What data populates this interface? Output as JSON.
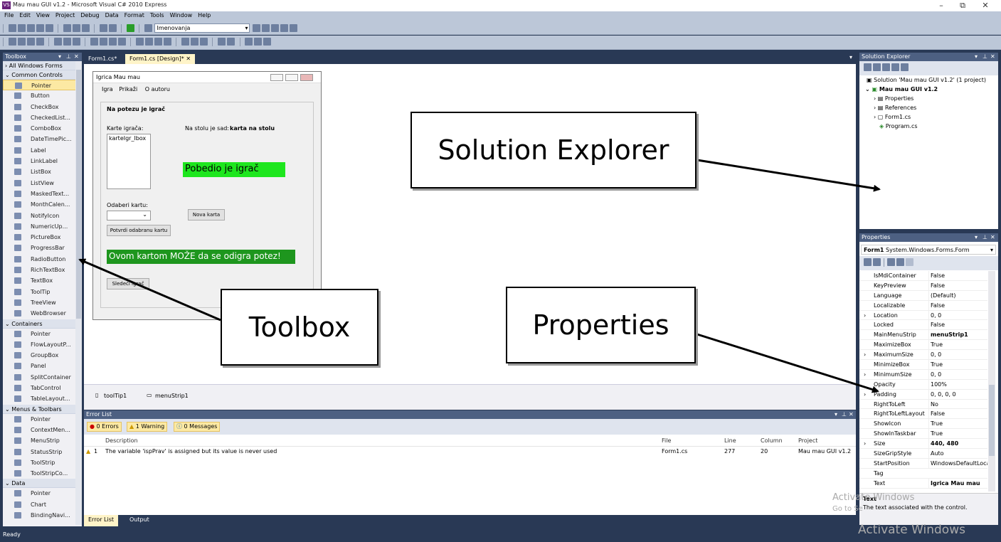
{
  "window": {
    "title": "Mau mau GUI v1.2 - Microsoft Visual C# 2010 Express",
    "app_icon": "vs-icon",
    "minimize": "–",
    "restore": "⧉",
    "close": "✕"
  },
  "menu": [
    "File",
    "Edit",
    "View",
    "Project",
    "Debug",
    "Data",
    "Format",
    "Tools",
    "Window",
    "Help"
  ],
  "toolbar": {
    "config_combo": "Imenovanja"
  },
  "toolbox": {
    "title": "Toolbox",
    "categories": [
      {
        "label": "All Windows Forms",
        "items": []
      },
      {
        "label": "Common Controls",
        "items": [
          "Pointer",
          "Button",
          "CheckBox",
          "CheckedList...",
          "ComboBox",
          "DateTimePic...",
          "Label",
          "LinkLabel",
          "ListBox",
          "ListView",
          "MaskedText...",
          "MonthCalen...",
          "NotifyIcon",
          "NumericUp...",
          "PictureBox",
          "ProgressBar",
          "RadioButton",
          "RichTextBox",
          "TextBox",
          "ToolTip",
          "TreeView",
          "WebBrowser"
        ]
      },
      {
        "label": "Containers",
        "items": [
          "Pointer",
          "FlowLayoutP...",
          "GroupBox",
          "Panel",
          "SplitContainer",
          "TabControl",
          "TableLayout..."
        ]
      },
      {
        "label": "Menus & Toolbars",
        "items": [
          "Pointer",
          "ContextMen...",
          "MenuStrip",
          "StatusStrip",
          "ToolStrip",
          "ToolStripCo..."
        ]
      },
      {
        "label": "Data",
        "items": [
          "Pointer",
          "Chart",
          "BindingNavi..."
        ]
      }
    ]
  },
  "doc_tabs": [
    {
      "label": "Form1.cs*"
    },
    {
      "label": "Form1.cs [Design]*"
    }
  ],
  "form": {
    "title": "Igrica Mau mau",
    "menu": [
      "Igra",
      "Prikaži",
      "O autoru"
    ],
    "turn_label": "Na potezu je igrač",
    "cards_label": "Karte igrača:",
    "listbox_text": "karteIgr_lbox",
    "table_label": "Na stolu je sad:",
    "table_value": "karta na stolu",
    "winner_text": "Pobedio je igrač",
    "choose_label": "Odaberi kartu:",
    "new_card_button": "Nova karta",
    "confirm_button": "Potvrdi odabranu kartu",
    "status_text": "Ovom kartom MOŽE da se odigra potez!",
    "next_button": "Sledeći igrač"
  },
  "tray": {
    "items": [
      "toolTip1",
      "menuStrip1"
    ]
  },
  "error_list": {
    "title": "Error List",
    "errors": "0 Errors",
    "warnings": "1 Warning",
    "messages": "0 Messages",
    "columns": [
      "Description",
      "File",
      "Line",
      "Column",
      "Project"
    ],
    "rows": [
      {
        "num": "1",
        "description": "The variable 'ispPrav' is assigned but its value is never used",
        "file": "Form1.cs",
        "line": "277",
        "column": "20",
        "project": "Mau mau GUI v1.2"
      }
    ]
  },
  "bottom_tabs": [
    "Error List",
    "Output"
  ],
  "solution_explorer": {
    "title": "Solution Explorer",
    "solution": "Solution 'Mau mau GUI v1.2' (1 project)",
    "project": "Mau mau GUI v1.2",
    "nodes": [
      "Properties",
      "References",
      "Form1.cs",
      "Program.cs"
    ]
  },
  "properties": {
    "title": "Properties",
    "object": "Form1",
    "object_type": "System.Windows.Forms.Form",
    "rows": [
      {
        "name": "IsMdiContainer",
        "value": "False"
      },
      {
        "name": "KeyPreview",
        "value": "False"
      },
      {
        "name": "Language",
        "value": "(Default)"
      },
      {
        "name": "Localizable",
        "value": "False"
      },
      {
        "name": "Location",
        "value": "0, 0"
      },
      {
        "name": "Locked",
        "value": "False"
      },
      {
        "name": "MainMenuStrip",
        "value": "menuStrip1"
      },
      {
        "name": "MaximizeBox",
        "value": "True"
      },
      {
        "name": "MaximumSize",
        "value": "0, 0"
      },
      {
        "name": "MinimizeBox",
        "value": "True"
      },
      {
        "name": "MinimumSize",
        "value": "0, 0"
      },
      {
        "name": "Opacity",
        "value": "100%"
      },
      {
        "name": "Padding",
        "value": "0, 0, 0, 0"
      },
      {
        "name": "RightToLeft",
        "value": "No"
      },
      {
        "name": "RightToLeftLayout",
        "value": "False"
      },
      {
        "name": "ShowIcon",
        "value": "True"
      },
      {
        "name": "ShowInTaskbar",
        "value": "True"
      },
      {
        "name": "Size",
        "value": "440, 480"
      },
      {
        "name": "SizeGripStyle",
        "value": "Auto"
      },
      {
        "name": "StartPosition",
        "value": "WindowsDefaultLoca"
      },
      {
        "name": "Tag",
        "value": ""
      },
      {
        "name": "Text",
        "value": "Igrica Mau mau"
      }
    ],
    "desc_title": "Text",
    "desc_text": "The text associated with the control."
  },
  "status_bar": "Ready",
  "callouts": {
    "solution_explorer": "Solution Explorer",
    "toolbox": "Toolbox",
    "properties": "Properties"
  },
  "watermark": {
    "small": "Activate Windows",
    "small2": "Go to Se",
    "large": "Activate Windows"
  }
}
